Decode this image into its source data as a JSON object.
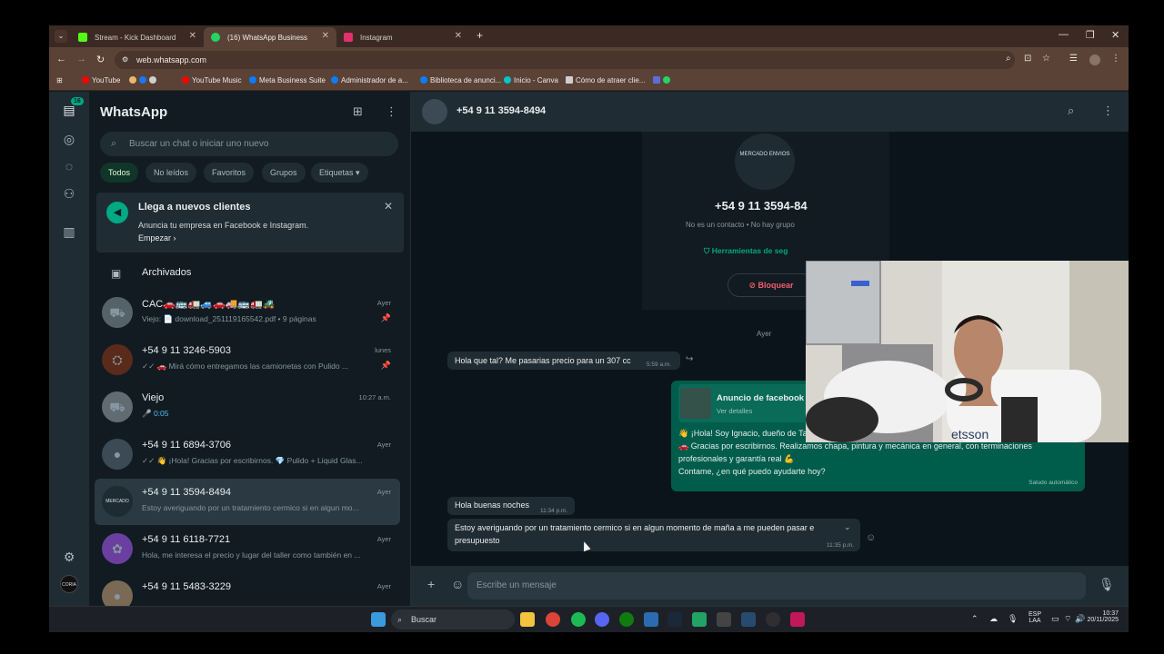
{
  "browser": {
    "tabs": [
      {
        "label": "Stream - Kick Dashboard",
        "favicon_color": "#53fc18"
      },
      {
        "label": "(16) WhatsApp Business",
        "favicon_color": "#25d366"
      },
      {
        "label": "Instagram",
        "favicon_color": "#e1306c"
      }
    ],
    "new_tab": "+",
    "url": "web.whatsapp.com",
    "bookmarks": [
      "YouTube",
      "YouTube Music",
      "Meta Business Suite",
      "Administrador de a...",
      "Biblioteca de anunci...",
      "Inicio - Canva",
      "Cómo de atraer clie..."
    ]
  },
  "rail": {
    "unread_badge": "16"
  },
  "sidebar": {
    "title": "WhatsApp",
    "search_placeholder": "Buscar un chat o iniciar uno nuevo",
    "filters": [
      "Todos",
      "No leídos",
      "Favoritos",
      "Grupos",
      "Etiquetas"
    ],
    "active_filter": "Todos",
    "promo": {
      "title": "Llega a nuevos clientes",
      "desc": "Anuncia tu empresa en Facebook e Instagram.",
      "link": "Empezar"
    },
    "archived_label": "Archivados",
    "chats": [
      {
        "name": "CAC🚗🚌🚛🚙🚗🚚🚌🚛🚜",
        "time": "Ayer",
        "preview": "Viejo: 📄 download_251119165542.pdf • 9 páginas",
        "pinned": true,
        "selected": false
      },
      {
        "name": "+54 9 11 3246-5903",
        "time": "lunes",
        "preview": "✓✓ 🚗 Mirá cómo entregamos las camionetas con Pulido ...",
        "pinned": true,
        "selected": false
      },
      {
        "name": "Viejo",
        "time": "10:27 a.m.",
        "preview": "🎤 0:05",
        "pinned": false,
        "selected": false
      },
      {
        "name": "+54 9 11 6894-3706",
        "time": "Ayer",
        "preview": "✓✓ 👋 ¡Hola! Gracias por escribirnos. 💎 Pulido + Liquid Glas...",
        "pinned": false,
        "selected": false
      },
      {
        "name": "+54 9 11 3594-8494",
        "time": "Ayer",
        "preview": "Estoy averiguando por un tratamiento cermico si en algun mo...",
        "pinned": false,
        "selected": true
      },
      {
        "name": "+54 9 11 6118-7721",
        "time": "Ayer",
        "preview": "Hola, me interesa el precio y lugar del taller como también en ...",
        "pinned": false,
        "selected": false
      },
      {
        "name": "+54 9 11 5483-3229",
        "time": "Ayer",
        "preview": "",
        "pinned": false,
        "selected": false
      }
    ]
  },
  "conversation": {
    "contact": "+54 9 11 3594-8494",
    "info": {
      "logo_text": "MERCADO ENVIOS",
      "number": "+54 9 11 3594-84",
      "subtitle": "No es un contacto • No hay grupo",
      "tools": "Herramientas de seg",
      "block": "Bloquear"
    },
    "date_separator": "Ayer",
    "messages": [
      {
        "text": "Hola que tal? Me pasarias precio para un 307 cc",
        "time": "5:59 a.m."
      },
      {
        "text": "Hola buenas noches",
        "time": "11:34 p.m."
      },
      {
        "text_line1": "Estoy averiguando por un tratamiento cermico si en algun momento de maña a me pueden pasar e",
        "text_line2": "presupuesto",
        "time": "11:35 p.m."
      }
    ],
    "ad_reply": {
      "title": "Anuncio de facebook",
      "link": "Ver detalles",
      "line1": "👋 ¡Hola! Soy Ignacio, dueño de Talleres Coria.",
      "line2": "🚗 Gracias por escribirnos. Realizamos chapa, pintura y mecánica en general, con terminaciones",
      "line3": "profesionales y garantía real 💪",
      "line4": "Contame, ¿en qué puedo ayudarte hoy?",
      "auto_label": "Saludo automático"
    },
    "composer_placeholder": "Escribe un mensaje"
  },
  "taskbar": {
    "search": "Buscar",
    "lang": "ESP",
    "lang2": "LAA",
    "time": "10:37",
    "date": "20/11/2025"
  }
}
